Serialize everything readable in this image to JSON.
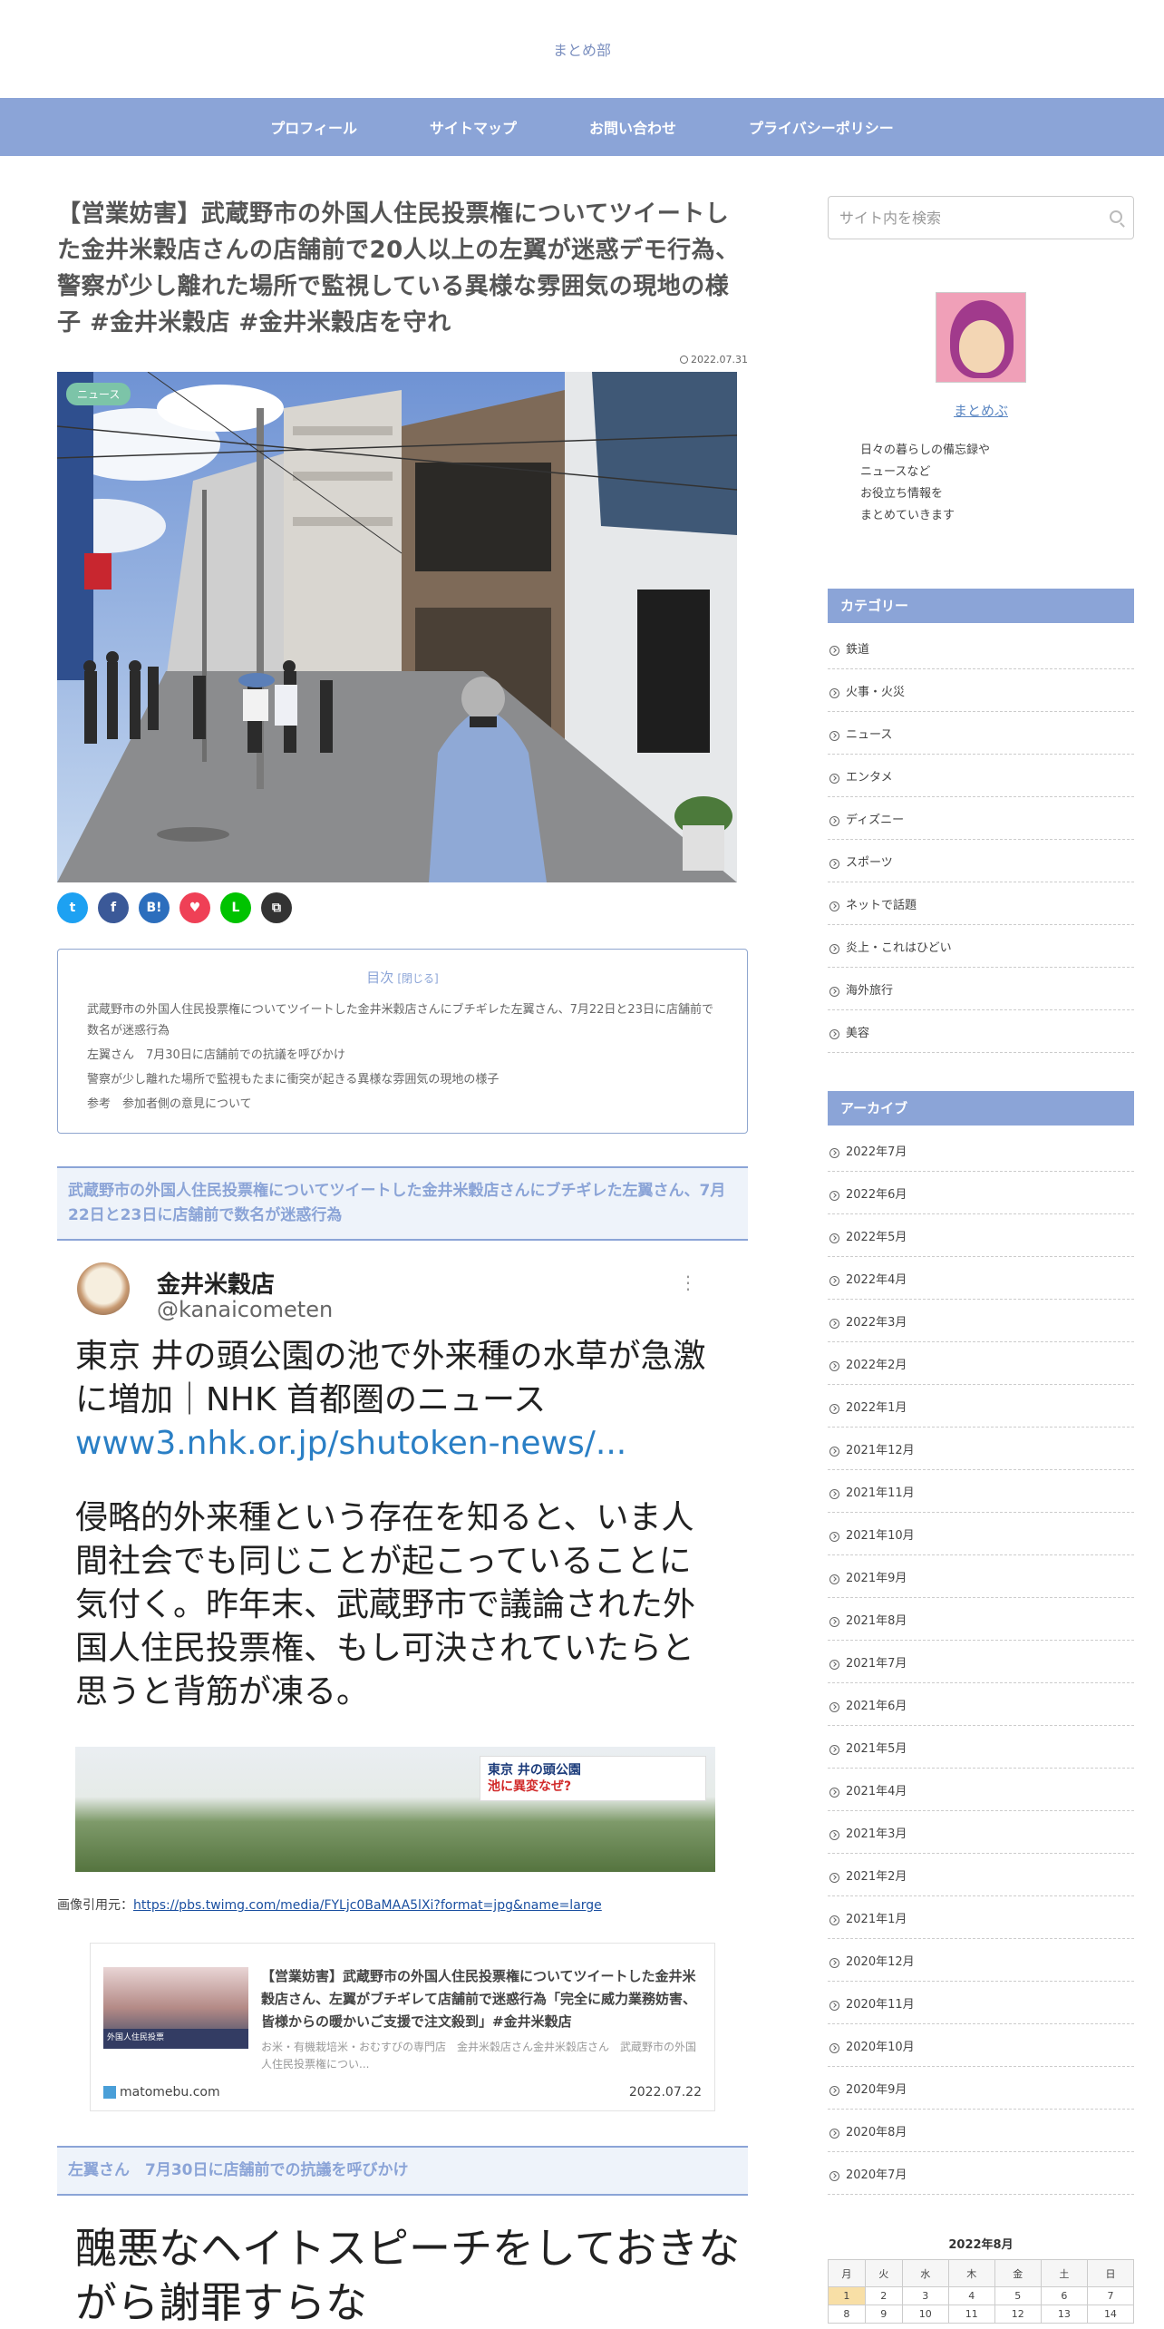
{
  "site": {
    "title": "まとめ部"
  },
  "nav": [
    "プロフィール",
    "サイトマップ",
    "お問い合わせ",
    "プライバシーポリシー"
  ],
  "article": {
    "title": "【営業妨害】武蔵野市の外国人住民投票権についてツイートした金井米穀店さんの店舗前で20人以上の左翼が迷惑デモ行為、警察が少し離れた場所で監視している異様な雰囲気の現地の様子 #金井米穀店 #金井米穀店を守れ",
    "date": "2022.07.31",
    "category": "ニュース",
    "share_buttons": [
      {
        "name": "twitter",
        "glyph": "t",
        "color": "#1da1f2"
      },
      {
        "name": "facebook",
        "glyph": "f",
        "color": "#3b5998"
      },
      {
        "name": "hatena",
        "glyph": "B!",
        "color": "#2c6ebd"
      },
      {
        "name": "pocket",
        "glyph": "♥",
        "color": "#ef4056"
      },
      {
        "name": "line",
        "glyph": "L",
        "color": "#00c300"
      },
      {
        "name": "copy",
        "glyph": "⧉",
        "color": "#333333"
      }
    ],
    "toc": {
      "title": "目次",
      "toggle": "[閉じる]",
      "items": [
        "武蔵野市の外国人住民投票権についてツイートした金井米穀店さんにブチギレた左翼さん、7月22日と23日に店舗前で数名が迷惑行為",
        "左翼さん　7月30日に店舗前での抗議を呼びかけ",
        "警察が少し離れた場所で監視もたまに衝突が起きる異様な雰囲気の現地の様子",
        "参考　参加者側の意見について"
      ]
    },
    "section1": {
      "heading": "武蔵野市の外国人住民投票権についてツイートした金井米穀店さんにブチギレた左翼さん、7月22日と23日に店舗前で数名が迷惑行為",
      "tweet": {
        "name": "金井米穀店",
        "handle": "@kanaicometen",
        "line1": "東京 井の頭公園の池で外来種の水草が急激に増加｜NHK 首都圏のニュース",
        "link": "www3.nhk.or.jp/shutoken-news/...",
        "body": "侵略的外来種という存在を知ると、いま人間社会でも同じことが起こっていることに気付く。昨年末、武蔵野市で議論された外国人住民投票権、もし可決されていたらと思うと背筋が凍る。",
        "thumb_caption": "東京 井の頭公園",
        "thumb_sub": "池に異変なぜ?"
      },
      "source_label": "画像引用元：",
      "source_url": "https://pbs.twimg.com/media/FYLjc0BaMAA5lXi?format=jpg&name=large"
    },
    "blogcard": {
      "title": "【営業妨害】武蔵野市の外国人住民投票権についてツイートした金井米穀店さん、左翼がブチギレて店舗前で迷惑行為「完全に威力業務妨害、皆様からの暖かいご支援で注文殺到」#金井米穀店",
      "snippet": "お米・有機栽培米・おむすびの専門店　金井米穀店さん金井米穀店さん　武蔵野市の外国人住民投票権につい...",
      "thumb_text": "外国人住民投票",
      "site": "matomebu.com",
      "date": "2022.07.22"
    },
    "section2": {
      "heading": "左翼さん　7月30日に店舗前での抗議を呼びかけ",
      "image_text": "醜悪なヘイトスピーチをしておきながら謝罪すらな"
    }
  },
  "sidebar": {
    "search_placeholder": "サイト内を検索",
    "profile": {
      "name": "まとめぶ",
      "desc": [
        "日々の暮らしの備忘録や",
        "ニュースなど",
        "お役立ち情報を",
        "まとめていきます"
      ]
    },
    "categories_title": "カテゴリー",
    "categories": [
      "鉄道",
      "火事・火災",
      "ニュース",
      "エンタメ",
      "ディズニー",
      "スポーツ",
      "ネットで話題",
      "炎上・これはひどい",
      "海外旅行",
      "美容"
    ],
    "archive_title": "アーカイブ",
    "archives": [
      "2022年7月",
      "2022年6月",
      "2022年5月",
      "2022年4月",
      "2022年3月",
      "2022年2月",
      "2022年1月",
      "2021年12月",
      "2021年11月",
      "2021年10月",
      "2021年9月",
      "2021年8月",
      "2021年7月",
      "2021年6月",
      "2021年5月",
      "2021年4月",
      "2021年3月",
      "2021年2月",
      "2021年1月",
      "2020年12月",
      "2020年11月",
      "2020年10月",
      "2020年9月",
      "2020年8月",
      "2020年7月"
    ],
    "calendar": {
      "caption": "2022年8月",
      "weekdays": [
        "月",
        "火",
        "水",
        "木",
        "金",
        "土",
        "日"
      ],
      "rows": [
        [
          "1",
          "2",
          "3",
          "4",
          "5",
          "6",
          "7"
        ],
        [
          "8",
          "9",
          "10",
          "11",
          "12",
          "13",
          "14"
        ]
      ],
      "today": "1"
    }
  }
}
